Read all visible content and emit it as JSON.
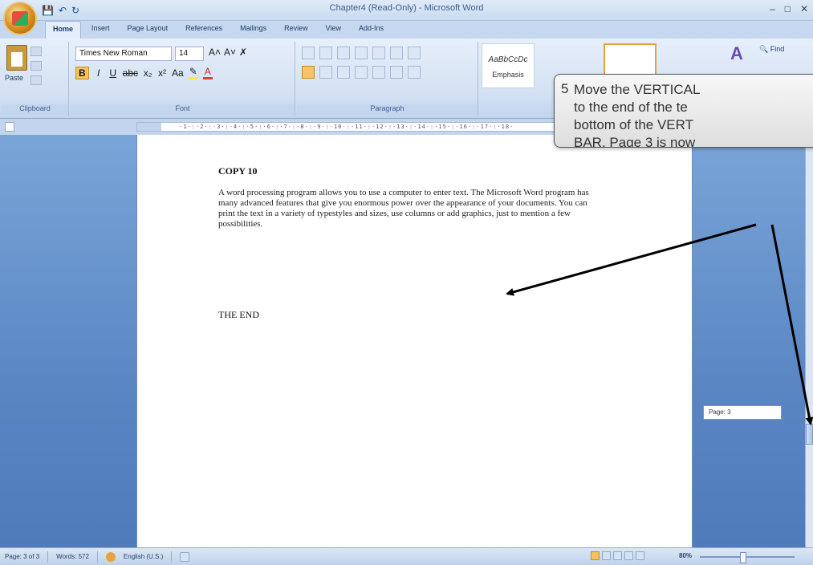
{
  "app": {
    "window_title": "Chapter4 (Read-Only) - Microsoft Word",
    "qat_icons": [
      "save-icon",
      "undo-icon",
      "redo-icon"
    ]
  },
  "tabs": [
    {
      "label": "Home",
      "active": true
    },
    {
      "label": "Insert"
    },
    {
      "label": "Page Layout"
    },
    {
      "label": "References"
    },
    {
      "label": "Mailings"
    },
    {
      "label": "Review"
    },
    {
      "label": "View"
    },
    {
      "label": "Add-Ins"
    }
  ],
  "ribbon": {
    "clipboard": {
      "label": "Clipboard",
      "paste_label": "Paste"
    },
    "font": {
      "label": "Font",
      "font_name": "Times New Roman",
      "font_size": "14"
    },
    "paragraph": {
      "label": "Paragraph"
    },
    "styles": [
      {
        "sample": "AaBbCcDc",
        "name": "Emphasis"
      }
    ],
    "editing": {
      "find_label": "Find"
    }
  },
  "document": {
    "heading": "COPY 10",
    "paragraph": "A word processing program allows you to use a computer to enter text. The Microsoft Word program has many advanced features that give you enormous power over the appearance of your documents.  You can print the text in a variety of typestyles and sizes, use columns or add graphics, just to mention a few possibilities.",
    "end_text": "THE END"
  },
  "scroll_tooltip": "Page: 3",
  "status": {
    "page": "Page: 3 of 3",
    "words": "Words: 572",
    "language": "English (U.S.)",
    "zoom": "80%"
  },
  "callout": {
    "number": "5",
    "lines": [
      "Move the VERTICAL",
      "to the end of the te",
      "bottom of the VERT",
      "BAR.  Page 3 is now"
    ]
  }
}
